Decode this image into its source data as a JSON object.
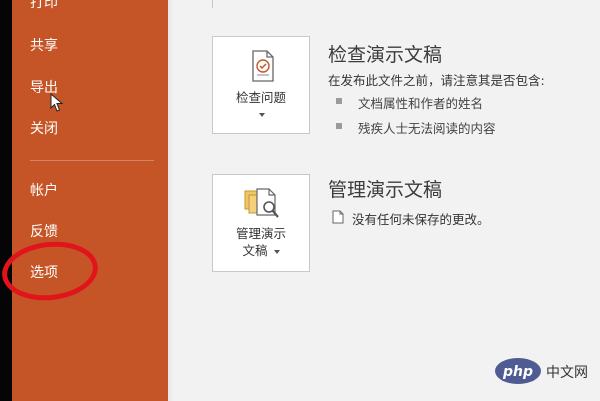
{
  "sidebar": {
    "items": [
      {
        "label": "打印"
      },
      {
        "label": "共享"
      },
      {
        "label": "导出"
      },
      {
        "label": "关闭"
      },
      {
        "label": "帐户"
      },
      {
        "label": "反馈"
      },
      {
        "label": "选项"
      }
    ]
  },
  "inspect": {
    "button_label": "检查问题",
    "title": "检查演示文稿",
    "description": "在发布此文件之前，请注意其是否包含:",
    "bullets": [
      "文档属性和作者的姓名",
      "残疾人士无法阅读的内容"
    ]
  },
  "manage": {
    "button_label_line1": "管理演示",
    "button_label_line2": "文稿",
    "title": "管理演示文稿",
    "description": "没有任何未保存的更改。"
  },
  "watermark": {
    "logo_text": "php",
    "site_text": "中文网"
  },
  "colors": {
    "sidebar": "#c55527",
    "highlight": "#e2141b",
    "watermark": "#4f5b93"
  }
}
